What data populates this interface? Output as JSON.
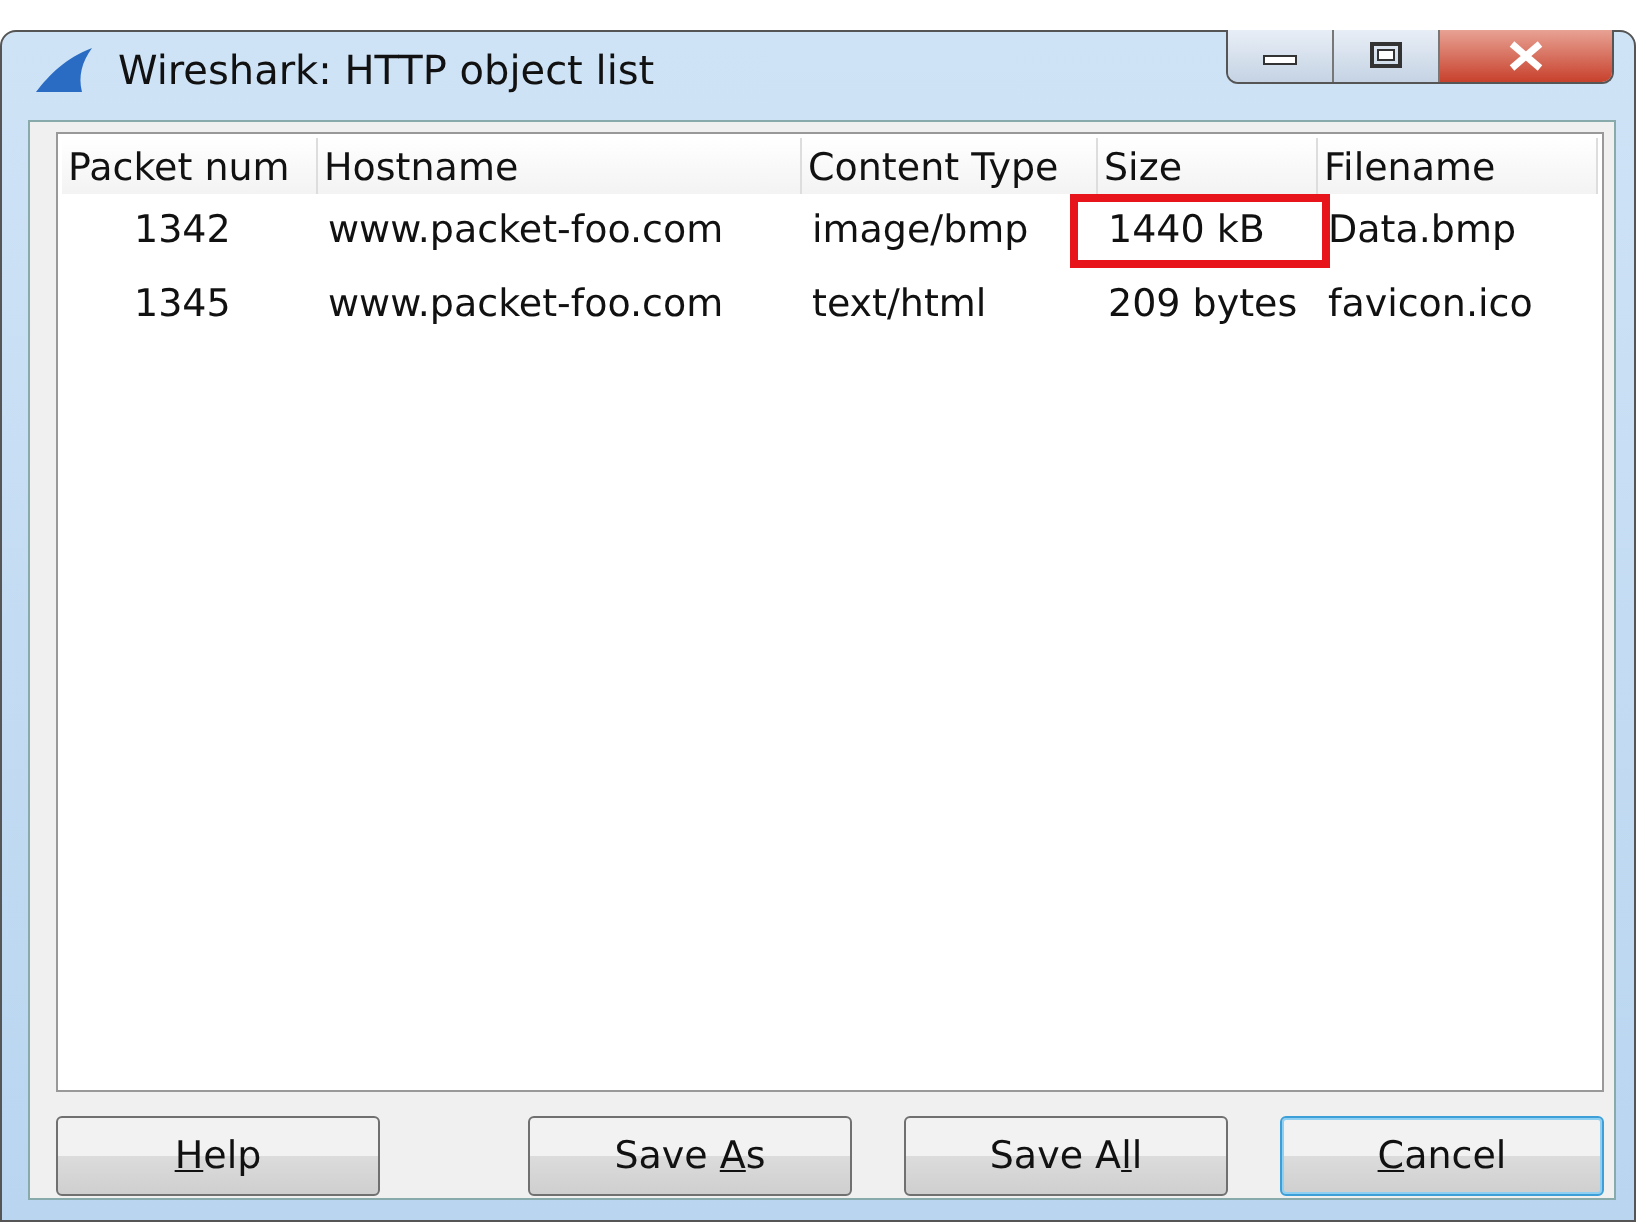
{
  "window": {
    "title": "Wireshark: HTTP object list"
  },
  "table": {
    "columns": [
      "Packet num",
      "Hostname",
      "Content Type",
      "Size",
      "Filename"
    ],
    "rows": [
      {
        "cells": [
          "1342",
          "www.packet-foo.com",
          "image/bmp",
          "1440 kB",
          "Data.bmp"
        ],
        "size_highlighted": true
      },
      {
        "cells": [
          "1345",
          "www.packet-foo.com",
          "text/html",
          "209 bytes",
          "favicon.ico"
        ],
        "size_highlighted": false
      }
    ]
  },
  "buttons": [
    {
      "key": "H",
      "after": "elp",
      "default": false
    },
    {
      "before": "Save ",
      "key": "A",
      "after": "s",
      "default": false
    },
    {
      "before": "Save A",
      "key": "l",
      "after": "l",
      "default": false
    },
    {
      "key": "C",
      "after": "ancel",
      "default": true
    }
  ]
}
